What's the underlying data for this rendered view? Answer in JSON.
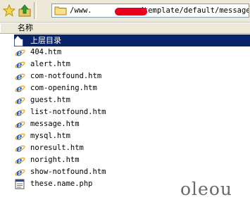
{
  "address_bar": {
    "text_prefix": "/www.",
    "text_suffix": "com/template/default/message/"
  },
  "list": {
    "column_name": "名称",
    "items": [
      {
        "label": "上层目录",
        "icon": "up-folder-icon",
        "selected": true
      },
      {
        "label": "404.htm",
        "icon": "ie-document-icon"
      },
      {
        "label": "alert.htm",
        "icon": "ie-document-icon"
      },
      {
        "label": "com-notfound.htm",
        "icon": "ie-document-icon"
      },
      {
        "label": "com-opening.htm",
        "icon": "ie-document-icon"
      },
      {
        "label": "guest.htm",
        "icon": "ie-document-icon"
      },
      {
        "label": "list-notfound.htm",
        "icon": "ie-document-icon"
      },
      {
        "label": "message.htm",
        "icon": "ie-document-icon"
      },
      {
        "label": "mysql.htm",
        "icon": "ie-document-icon"
      },
      {
        "label": "noresult.htm",
        "icon": "ie-document-icon"
      },
      {
        "label": "noright.htm",
        "icon": "ie-document-icon"
      },
      {
        "label": "show-notfound.htm",
        "icon": "ie-document-icon"
      },
      {
        "label": "these.name.php",
        "icon": "php-file-icon"
      }
    ]
  },
  "watermark": "oleou",
  "colors": {
    "selection": "#0a246a",
    "toolbar": "#ece9d8",
    "redaction": "#e8001c"
  }
}
